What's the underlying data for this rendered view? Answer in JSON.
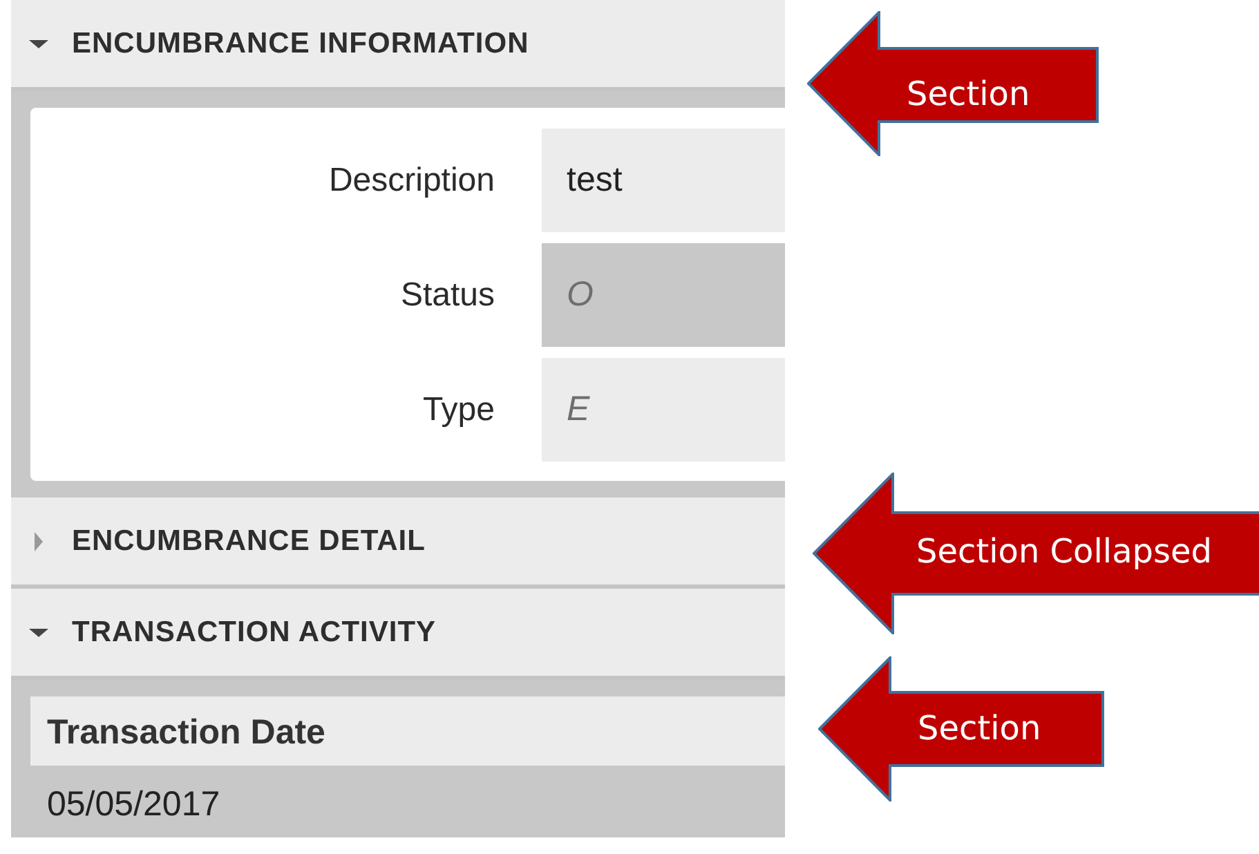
{
  "sections": [
    {
      "title": "ENCUMBRANCE INFORMATION",
      "expanded": true,
      "kind": "form",
      "fields": [
        {
          "label": "Description",
          "value": "test",
          "readonly": false,
          "highlighted": false
        },
        {
          "label": "Status",
          "value": "O",
          "readonly": true,
          "highlighted": true
        },
        {
          "label": "Type",
          "value": "E",
          "readonly": true,
          "highlighted": false
        }
      ]
    },
    {
      "title": "ENCUMBRANCE DETAIL",
      "expanded": false
    },
    {
      "title": "TRANSACTION ACTIVITY",
      "expanded": true,
      "kind": "table",
      "columns": [
        "Transaction Date"
      ],
      "rows": [
        [
          "05/05/2017"
        ]
      ]
    }
  ],
  "annotations": [
    {
      "label": "Section"
    },
    {
      "label": "Section Collapsed"
    },
    {
      "label": "Section"
    }
  ]
}
